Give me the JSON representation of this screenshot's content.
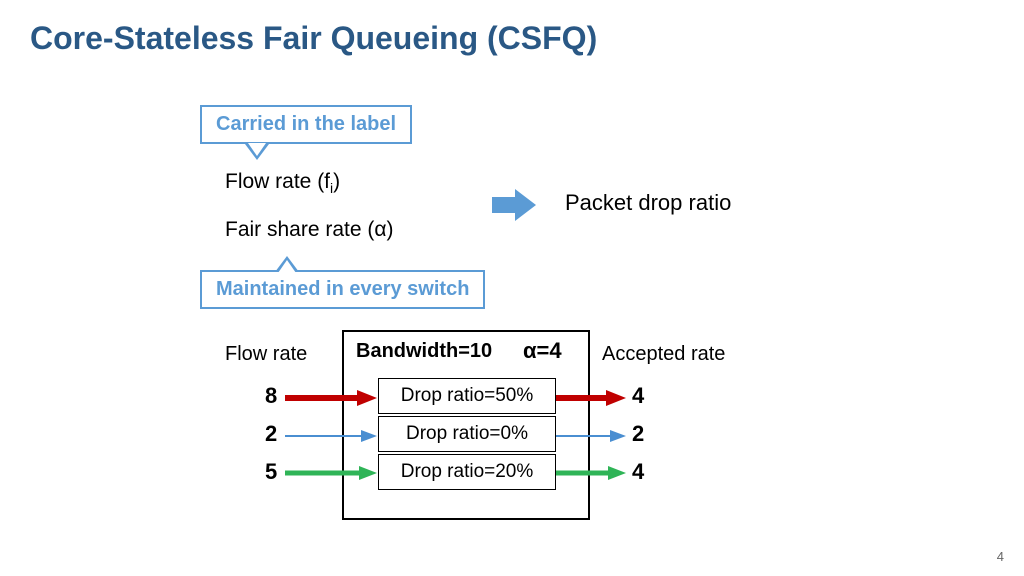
{
  "title": "Core-Stateless Fair Queueing (CSFQ)",
  "callout1": "Carried in the label",
  "callout2": "Maintained in every switch",
  "param1_pre": "Flow rate (f",
  "param1_sub": "i",
  "param1_post": ")",
  "param2": "Fair share rate (α)",
  "packet_drop_ratio": "Packet drop ratio",
  "bandwidth_label": "Bandwidth=10",
  "alpha_label": "α=4",
  "flow_rate_header": "Flow rate",
  "accepted_header": "Accepted rate",
  "flows": [
    {
      "rate": "8",
      "drop": "Drop ratio=50%",
      "accepted": "4",
      "color": "#c00000",
      "thick": 6
    },
    {
      "rate": "2",
      "drop": "Drop ratio=0%",
      "accepted": "2",
      "color": "#4a8ed1",
      "thick": 2
    },
    {
      "rate": "5",
      "drop": "Drop ratio=20%",
      "accepted": "4",
      "color": "#2fb457",
      "thick": 5
    }
  ],
  "page_number": "4"
}
